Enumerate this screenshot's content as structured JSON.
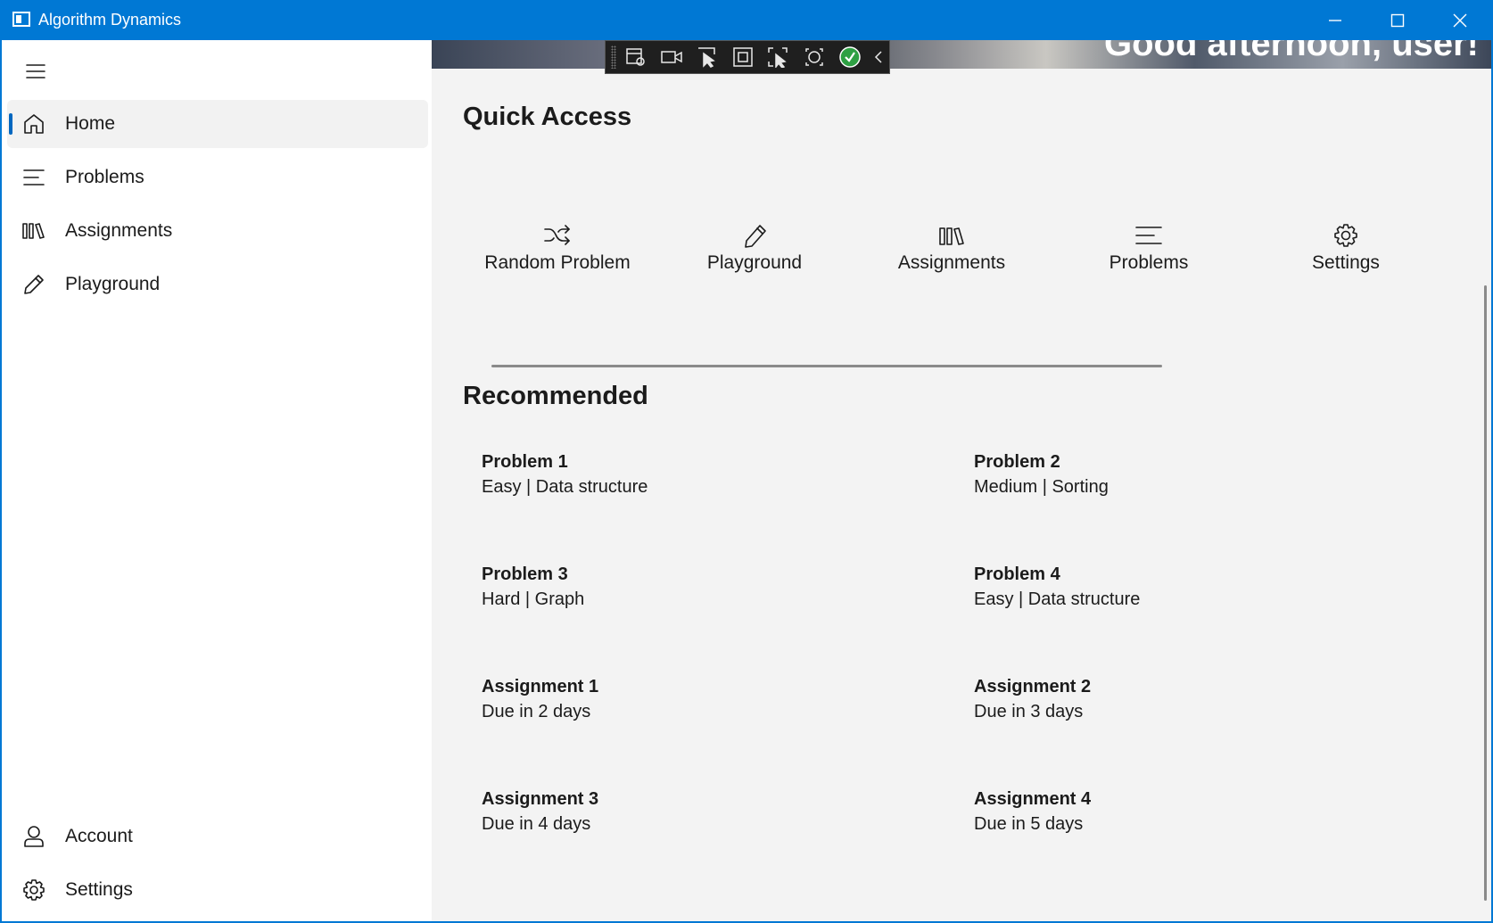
{
  "window": {
    "title": "Algorithm Dynamics"
  },
  "nav": {
    "items": [
      {
        "label": "Home",
        "icon": "home-icon",
        "selected": true
      },
      {
        "label": "Problems",
        "icon": "list-icon"
      },
      {
        "label": "Assignments",
        "icon": "library-icon"
      },
      {
        "label": "Playground",
        "icon": "pencil-icon"
      }
    ],
    "footer": [
      {
        "label": "Account",
        "icon": "person-icon"
      },
      {
        "label": "Settings",
        "icon": "gear-icon"
      }
    ]
  },
  "header": {
    "greeting": "Good afternoon, user!"
  },
  "quick_access": {
    "title": "Quick Access",
    "items": [
      {
        "label": "Random Problem",
        "icon": "shuffle-icon"
      },
      {
        "label": "Playground",
        "icon": "pencil-icon"
      },
      {
        "label": "Assignments",
        "icon": "library-icon"
      },
      {
        "label": "Problems",
        "icon": "list-icon"
      },
      {
        "label": "Settings",
        "icon": "gear-icon"
      }
    ]
  },
  "recommended": {
    "title": "Recommended",
    "items": [
      {
        "title": "Problem 1",
        "subtitle": "Easy | Data structure"
      },
      {
        "title": "Problem 2",
        "subtitle": "Medium | Sorting"
      },
      {
        "title": "Problem 3",
        "subtitle": "Hard | Graph"
      },
      {
        "title": "Problem 4",
        "subtitle": "Easy | Data structure"
      },
      {
        "title": "Assignment 1",
        "subtitle": "Due in 2 days"
      },
      {
        "title": "Assignment 2",
        "subtitle": "Due in 3 days"
      },
      {
        "title": "Assignment 3",
        "subtitle": "Due in 4 days"
      },
      {
        "title": "Assignment 4",
        "subtitle": "Due in 5 days"
      }
    ]
  },
  "theme": {
    "accent": "#0078d4",
    "nav_indicator": "#0067c0",
    "status_ok": "#2ea043"
  }
}
